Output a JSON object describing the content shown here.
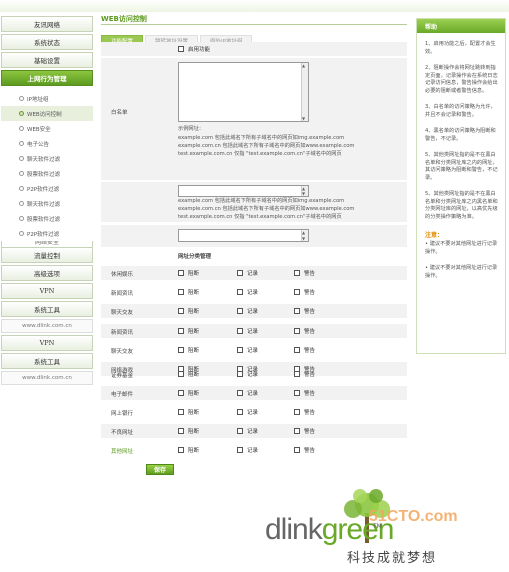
{
  "sidebar": {
    "items": [
      {
        "label": "友讯网络",
        "active": false
      },
      {
        "label": "系统状态",
        "active": false
      },
      {
        "label": "基础设置",
        "active": false
      },
      {
        "label": "上网行为管理",
        "active": true
      }
    ],
    "subitems": [
      {
        "label": "IP地址组",
        "selected": false
      },
      {
        "label": "WEB访问控制",
        "selected": true
      },
      {
        "label": "WEB安全",
        "selected": false
      },
      {
        "label": "电子公告",
        "selected": false
      },
      {
        "label": "聊天软件过滤",
        "selected": false
      },
      {
        "label": "股票软件过滤",
        "selected": false
      },
      {
        "label": "P2P软件过滤",
        "selected": false
      },
      {
        "label": "聊天软件过滤",
        "selected": false
      },
      {
        "label": "股票软件过滤",
        "selected": false
      },
      {
        "label": "P2P软件过滤",
        "selected": false
      }
    ],
    "cut_label": "网络安全",
    "lower_items": [
      "流量控制",
      "高级选项",
      "VPN",
      "系统工具"
    ],
    "domain1": "www.dlink.com.cn",
    "lower_items2": [
      "VPN",
      "系统工具"
    ],
    "domain2": "www.dlink.com.cn"
  },
  "main": {
    "title": "WEB访问控制",
    "tabs": [
      {
        "label": "功能配置",
        "active": true
      },
      {
        "label": "跳转地址设置",
        "active": false
      },
      {
        "label": "例外IP地址组",
        "active": false
      }
    ],
    "enable_label": "启用功能",
    "whitelist_label": "白名单",
    "example_label": "示例网址：",
    "note_lines": [
      "example.com 包括此域名下所有子域名中的网页如img.example.com",
      "example.com.cn 包括此域名下所有子域名中的网页如www.example.com",
      "test.example.com.cn 仅指 \"test.example.com.cn\"子域名中的网页"
    ],
    "category_header": "网址分类管理",
    "col_block": "阻断",
    "col_log": "记录",
    "col_warn": "警告",
    "categories_a": [
      "休闲娱乐",
      "新闻资讯",
      "聊天交友",
      "网络游戏"
    ],
    "categories_b": [
      "新闻资讯",
      "聊天交友",
      "网络游戏"
    ],
    "categories_c": [
      "证券基金",
      "电子邮件",
      "网上银行",
      "不良网址",
      "其他网址"
    ],
    "save_label": "保存"
  },
  "help": {
    "title": "帮助",
    "items": [
      "1、启用功能之后，配置才会生效。",
      "2、阻断操作会将网址跳转到指定页面，记录操作会在系统日志记录访问信息，警告操作会给出必要的阻断或者警告信息。",
      "3、白名单的访问策略为允许，并且不会记录和警告。",
      "4、黑名单的访问策略为阻断和警告，不记录。",
      "5、其他类网址指的是不在黑白名单和分类网址库之内的网址，其访问策略为阻断和警告，不记录。",
      "5、其他类网址指的是不在黑白名单和分类网址库之内黑名单和分类网址库的网址，以高优先级的分类操作策略为准。"
    ],
    "warn_title": "注意：",
    "warn_text": "• 建议不要对其他网址进行记录操作。",
    "warn_text2": "• 建议不要对其他网址进行记录操作。"
  },
  "logo": {
    "brand_a": "dlink",
    "brand_b": "green",
    "tm": "TM",
    "site": "51CTO.com",
    "slogan": "科技成就梦想"
  },
  "colors": {
    "accent": "#5c9a1f",
    "nav_active": "#7bb536",
    "help_header": "#8cc63f",
    "warn": "#e08c00"
  }
}
